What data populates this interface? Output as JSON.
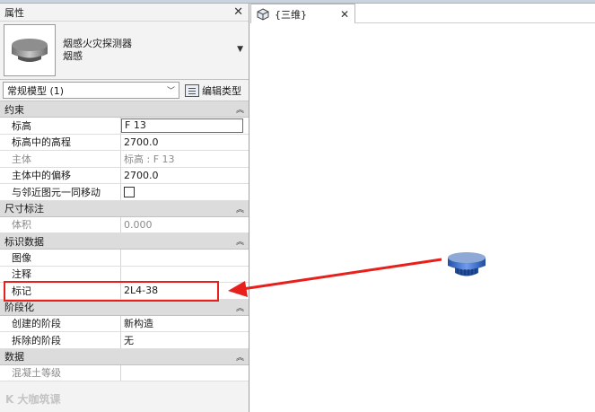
{
  "properties_panel": {
    "title": "属性",
    "type_selector": {
      "family": "烟感火灾探测器",
      "type": "烟感"
    },
    "instance_filter": "常规模型 (1)",
    "edit_type_label": "编辑类型",
    "sections": [
      {
        "title": "约束",
        "rows": [
          {
            "label": "标高",
            "value": "F 13",
            "editable": true,
            "enabled": true
          },
          {
            "label": "标高中的高程",
            "value": "2700.0",
            "enabled": true
          },
          {
            "label": "主体",
            "value": "标高 : F 13",
            "enabled": false
          },
          {
            "label": "主体中的偏移",
            "value": "2700.0",
            "enabled": true
          },
          {
            "label": "与邻近图元一同移动",
            "value": "",
            "checkbox": true,
            "enabled": true
          }
        ]
      },
      {
        "title": "尺寸标注",
        "rows": [
          {
            "label": "体积",
            "value": "0.000",
            "enabled": false
          }
        ]
      },
      {
        "title": "标识数据",
        "rows": [
          {
            "label": "图像",
            "value": "",
            "enabled": true
          },
          {
            "label": "注释",
            "value": "",
            "enabled": true
          },
          {
            "label": "标记",
            "value": "2L4-38",
            "enabled": true,
            "highlighted": true
          }
        ]
      },
      {
        "title": "阶段化",
        "rows": [
          {
            "label": "创建的阶段",
            "value": "新构造",
            "enabled": true
          },
          {
            "label": "拆除的阶段",
            "value": "无",
            "enabled": true
          }
        ]
      },
      {
        "title": "数据",
        "rows": [
          {
            "label": "混凝土等级",
            "value": "",
            "enabled": false
          }
        ]
      }
    ]
  },
  "view": {
    "tab_label": "{三维}"
  },
  "watermark": "K 大咖筑课",
  "colors": {
    "annotation_red": "#e8201c",
    "detector_blue": "#3a6fd8"
  },
  "icons": {
    "collapse": "chevron-up-icon",
    "close": "close-icon",
    "view3d": "cube-icon"
  }
}
